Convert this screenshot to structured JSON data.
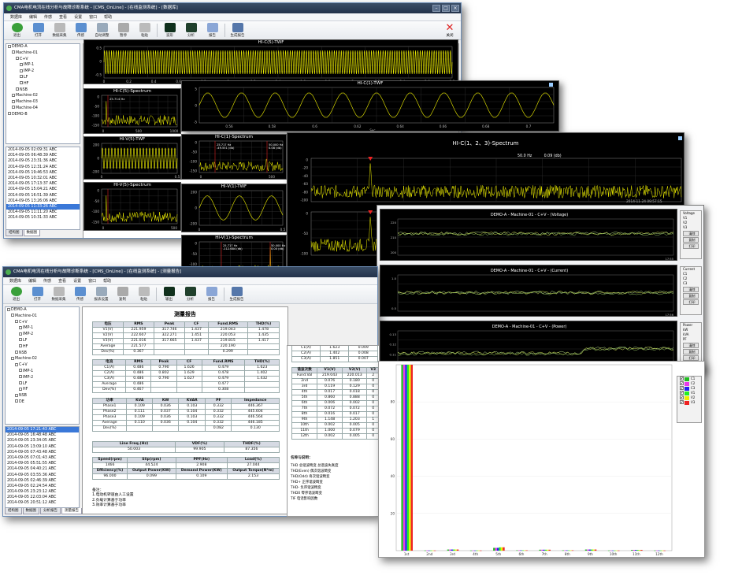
{
  "win1": {
    "title": "CMA电机电流在线分析与故障诊断系统 - [CMS_OnLine] - [在线监测系统] - [数据库]",
    "menu": [
      "数据库",
      "编辑",
      "传感",
      "查看",
      "设置",
      "窗口",
      "帮助"
    ],
    "toolbar": [
      "退出",
      "打开",
      "数据采集",
      "传感",
      "自动调整",
      "暂停",
      "粘贴",
      "波形",
      "分析",
      "报告",
      "生成报告"
    ],
    "close_label": "关闭",
    "tree": [
      "DEMO-A",
      "Machine-01",
      "C+V",
      "IMP-1",
      "IMP-2",
      "LF",
      "HF",
      "NSB",
      "Machine-02",
      "Machine-03",
      "Machine-04",
      "DEMO-B"
    ],
    "dates": [
      "2014-09-05 02:09:31 ABC",
      "2014-09-05 06:48:39 ABC",
      "2014-09-05 23:31:36 ABC",
      "2014-09-05 12:31:24 ABC",
      "2014-09-05 19:46:53 ABC",
      "2014-09-05 10:32:01 ABC",
      "2014-09-05 17:13:37 ABC",
      "2014-09-05 15:04:21 ABC",
      "2014-09-05 16:51:39 ABC",
      "2014-09-05 13:26:06 ABC",
      "2014-09-05 11:33:26 ABC",
      "2014-09-05 11:11:20 ABC",
      "2014-09-05 10:31:33 ABC"
    ],
    "tabs": [
      "结构图",
      "数据图"
    ],
    "top_chart_title": "HI-C(5)-TWF",
    "top_x": [
      "0",
      "0.2",
      "0.4",
      "0.6",
      "0.8",
      "1",
      "1.2",
      "1.4",
      "1.6",
      "1.8",
      "2",
      "2.2",
      "2.4",
      "2.6",
      "2.8"
    ],
    "top_y": [
      "0.5",
      "0",
      "-0.5"
    ],
    "spec1_title": "HI-C(5)-Spectrum",
    "spec1_y": [
      "0",
      "-50",
      "-100",
      "-150"
    ],
    "spec1_x": [
      "0",
      "500",
      "1000"
    ],
    "spec1_marker": "25.714 Hz\n-40.600 (db)",
    "twf2_title": "HI-V(5)-TWF",
    "twf2_y": [
      "200",
      "0",
      "-200"
    ],
    "twf2_x": [
      "0",
      "0.5"
    ],
    "spec2_title": "HI-V(5)-Spectrum",
    "spec2_y": [
      "0",
      "-50",
      "-100",
      "-150"
    ],
    "spec2_x": [
      "0",
      "500"
    ]
  },
  "win2": {
    "title": "HI-C(1)-TWF",
    "x": [
      "0.56",
      "0.58",
      "0.6",
      "0.62",
      "0.64",
      "0.66",
      "0.68",
      "0.7"
    ],
    "xlabel": "Sec",
    "y": [
      "5",
      "0",
      "-5"
    ],
    "spec_title": "HI-C(1)-Spectrum",
    "spec_marker": "25.717 Hz\n-49.551 (db)",
    "spec_marker2": "50.000 Hz\n0.08 (db)",
    "spec_y": [
      "0",
      "-50",
      "-100",
      "-150"
    ],
    "spec_x": [
      "0",
      "500"
    ],
    "twf_title": "HI-V(1)-TWF",
    "twf_y": [
      "200",
      "0",
      "-200"
    ],
    "twf_x": [
      "0",
      "0.5"
    ],
    "vspec_title": "HI-V(1)-Spectrum",
    "vspec_marker": "25.717 Hz\n-112.684 (db)",
    "vspec_marker2": "50.000 Hz\n0.00 (db)",
    "vspec_y": [
      "0",
      "-50",
      "-100",
      "-150"
    ],
    "vspec_x": [
      "0",
      "500",
      "1000"
    ]
  },
  "win3": {
    "title": "HI-C(1、2、3)-Spectrum",
    "readout": "50.0 Hz          0.09 (db)",
    "date": "2014-11-24 09:57:15",
    "y1": [
      "0",
      "-20",
      "-40",
      "-60",
      "-80",
      "-100"
    ],
    "y2": [
      "0",
      "-50",
      "-100"
    ],
    "y3": [
      "-20",
      "-40",
      "-60",
      "-80",
      "-100"
    ],
    "unit": "(db)"
  },
  "win4": {
    "charts": [
      {
        "title": "DEMO-A - Machine-01 - C+V - (Voltage)",
        "y": [
          "220",
          "210",
          "200"
        ],
        "legend": [
          "Voltage",
          "V1",
          "V2",
          "V3"
        ],
        "time": "17:55"
      },
      {
        "title": "DEMO-A - Machine-01 - C+V - (Current)",
        "y": [
          "1.0",
          "0.5"
        ],
        "legend": [
          "Current",
          "C1",
          "C2",
          "C3"
        ],
        "time": "17:56"
      },
      {
        "title": "DEMO-A - Machine-01 - C+V - (Power)",
        "y": [
          "0.13",
          "0.12",
          "0.11",
          "0.10"
        ],
        "legend": [
          "Power",
          "kW",
          "kVA",
          "PF"
        ],
        "time": "17:40"
      }
    ],
    "btn1": "清除",
    "btn2": "复制",
    "btn3": "打印"
  },
  "win5": {
    "title": "CMA电机电流在线分析与故障诊断系统 - [CMS_OnLine] - [在线监测系统] - [测量报告]",
    "menu": [
      "数据库",
      "编辑",
      "传感",
      "查看",
      "设置",
      "窗口",
      "帮助"
    ],
    "toolbar": [
      "退出",
      "打开",
      "数据采集",
      "传感",
      "报表设置",
      "复制",
      "粘贴",
      "输出",
      "分析",
      "报告",
      "生成报告"
    ],
    "tree": [
      "DEMO-A",
      "Machine-01",
      "C+V",
      "IMP-1",
      "IMP-2",
      "LF",
      "HF",
      "NSB",
      "Machine-02",
      "C+V",
      "IMP-1",
      "IMP-2",
      "LF",
      "HF",
      "NSB",
      "DE"
    ],
    "dates": [
      "2014-09-05 17:21:43 ABC",
      "2014-09-05 16:48:48 ABC",
      "2014-09-05 23:34:05 ABC",
      "2014-09-05 13:09:10 ABC",
      "2014-09-05 07:43:48 ABC",
      "2014-09-05 07:01:43 ABC",
      "2014-09-05 05:51:55 ABC",
      "2014-09-05 04:40:21 ABC",
      "2014-09-05 03:55:36 ABC",
      "2014-09-05 02:46:39 ABC",
      "2014-09-05 02:24:54 ABC",
      "2014-09-05 23:23:12 ABC",
      "2014-09-05 22:03:04 ABC",
      "2014-09-05 20:51:12 ABC"
    ],
    "tabs": [
      "结构图",
      "数据图",
      "分析报告",
      "测量报告"
    ],
    "report_title": "测量报告",
    "vt": {
      "head": [
        "电压",
        "RMS",
        "Peak",
        "CF",
        "Fund.RMS",
        "THD(%)"
      ],
      "rows": [
        [
          "V1(V)",
          "221.959",
          "317.746",
          "1.437",
          "219.043",
          "1.478"
        ],
        [
          "V2(V)",
          "222.607",
          "322.271",
          "1.451",
          "220.053",
          "1.435"
        ],
        [
          "V3(V)",
          "221.016",
          "317.665",
          "1.437",
          "219.815",
          "1.417"
        ],
        [
          "Average",
          "221.577",
          "",
          "",
          "220.190",
          ""
        ],
        [
          "Dev(%)",
          "0.367",
          "",
          "",
          "0.299",
          ""
        ]
      ]
    },
    "ct": {
      "head": [
        "电流",
        "RMS",
        "Peak",
        "CF",
        "Fund.RMS",
        "THD(%)"
      ],
      "rows": [
        [
          "C1(A)",
          "0.486",
          "0.790",
          "1.626",
          "0.479",
          "1.623"
        ],
        [
          "C2(A)",
          "0.486",
          "0.802",
          "1.629",
          "0.478",
          "1.402"
        ],
        [
          "C3(A)",
          "0.486",
          "0.790",
          "1.627",
          "0.479",
          "1.432"
        ],
        [
          "Average",
          "0.486",
          "",
          "",
          "0.477",
          ""
        ],
        [
          "Dev(%)",
          "0.467",
          "",
          "",
          "0.308",
          ""
        ]
      ]
    },
    "pt": {
      "head": [
        "功率",
        "KVA",
        "KW",
        "KVAR",
        "PF",
        "Impedance"
      ],
      "rows": [
        [
          "Phase1",
          "0.109",
          "0.036",
          "0.103",
          "0.332",
          "446.367"
        ],
        [
          "Phase2",
          "0.111",
          "0.037",
          "0.104",
          "0.332",
          "445.604"
        ],
        [
          "Phase3",
          "0.109",
          "0.036",
          "0.103",
          "0.332",
          "446.564"
        ],
        [
          "Average",
          "0.110",
          "0.036",
          "0.104",
          "0.332",
          "446.185"
        ],
        [
          "Dev(%)",
          "",
          "",
          "",
          "0.082",
          "0.130"
        ]
      ]
    },
    "lt": {
      "head": [
        "Line Freq.(Hz)",
        "VDF(%)",
        "THDF(%)"
      ],
      "rows": [
        [
          "50.003",
          "99.905",
          "87.356"
        ]
      ]
    },
    "mt": {
      "head": [
        "Speed(rpm)",
        "Slip(rpm)",
        "PPF(Hz)",
        "Load(%)"
      ],
      "rows": [
        [
          "1466",
          "44.524",
          "2.908",
          "27.044"
        ]
      ],
      "head2": [
        "Efficiency(%)",
        "Output Power(KW)",
        "Demand Power(KW)",
        "Output Torque(N*m)"
      ],
      "rows2": [
        [
          "96.000",
          "0.099",
          "0.109",
          "2.153"
        ]
      ]
    },
    "notes_title": "备注：",
    "notes": [
      "1.电动机转速由人工设置",
      "2.负载计算基于功率",
      "3.效率计算基于功率"
    ]
  },
  "harm": {
    "head": [
      "谐波次数",
      "V1(V)",
      "V2(V)",
      "V3"
    ],
    "fund": [
      "Fund.Val",
      "219.043",
      "220.013",
      "2"
    ],
    "rows": [
      [
        "2nd",
        "0.076",
        "0.180",
        "0"
      ],
      [
        "3rd",
        "0.119",
        "0.129",
        "0"
      ],
      [
        "4th",
        "0.017",
        "0.018",
        "0"
      ],
      [
        "5th",
        "0.860",
        "0.888",
        "0"
      ],
      [
        "6th",
        "0.006",
        "0.002",
        "0"
      ],
      [
        "7th",
        "0.072",
        "0.072",
        "0"
      ],
      [
        "8th",
        "0.016",
        "0.017",
        "0"
      ],
      [
        "9th",
        "1.148",
        "1.203",
        "1"
      ],
      [
        "10th",
        "0.002",
        "0.005",
        "0"
      ],
      [
        "11th",
        "1.000",
        "0.079",
        "0"
      ],
      [
        "12th",
        "0.002",
        "0.005",
        "0"
      ]
    ],
    "prev": [
      [
        "C1(A)",
        "1.623",
        "0.009"
      ],
      [
        "C2(A)",
        "1.402",
        "0.008"
      ],
      [
        "C3(A)",
        "1.851",
        "0.007"
      ]
    ],
    "legend_title": "名称与说明：",
    "legend": [
      "THD 总谐波畸变 总谐波失真度",
      "THD(Even) 偶次谐波畸变",
      "THD(Odd) 奇次谐波畸变",
      "THD+ 正序谐波畸变",
      "THD- 负序谐波畸变",
      "THD0 零序谐波畸变",
      "TIF 电话影响因数"
    ]
  },
  "bar": {
    "legend": [
      "C1",
      "C2",
      "C3",
      "V1",
      "V2",
      "V3"
    ],
    "colors": [
      "#22bb22",
      "#e83ae8",
      "#2222ee",
      "#22ee22",
      "#eeee00",
      "#ee2222"
    ],
    "y": [
      "80",
      "60",
      "40",
      "20"
    ],
    "x": [
      "1st",
      "2nd",
      "3rd",
      "4th",
      "5th",
      "6th",
      "7th",
      "8th",
      "9th",
      "10th",
      "11th",
      "12th"
    ],
    "y_max": 100,
    "series": [
      [
        100,
        0.1,
        0.6,
        0.1,
        1.5,
        0.2,
        0.5,
        0.2,
        0.6,
        0.1,
        0.4,
        0.1
      ],
      [
        100,
        0.1,
        0.6,
        0.1,
        1.5,
        0.2,
        0.5,
        0.2,
        0.6,
        0.1,
        0.4,
        0.1
      ],
      [
        100,
        0.1,
        0.6,
        0.1,
        1.5,
        0.2,
        0.5,
        0.2,
        0.6,
        0.1,
        0.4,
        0.1
      ],
      [
        100,
        0.1,
        0.6,
        0.1,
        1.8,
        0.2,
        0.5,
        0.2,
        0.6,
        0.1,
        0.4,
        0.1
      ],
      [
        100,
        0.1,
        0.6,
        0.1,
        1.8,
        0.2,
        0.5,
        0.2,
        0.6,
        0.1,
        0.4,
        0.1
      ],
      [
        100,
        0.1,
        0.6,
        0.1,
        1.8,
        0.2,
        0.5,
        0.2,
        0.6,
        0.1,
        0.4,
        0.1
      ]
    ]
  }
}
